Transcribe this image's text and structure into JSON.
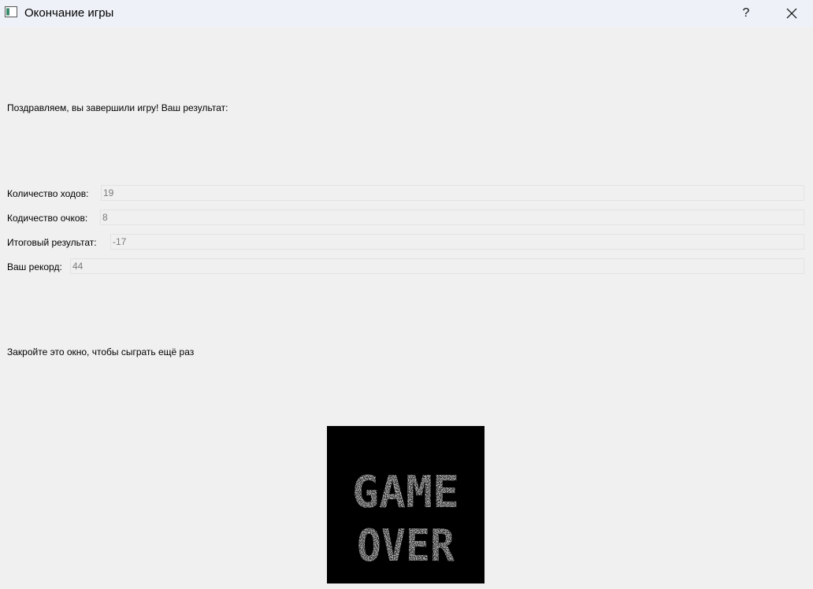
{
  "window": {
    "title": "Окончание игры",
    "help_label": "?"
  },
  "congrats_text": "Поздравляем, вы завершили игру! Ваш результат:",
  "fields": [
    {
      "label": "Количество ходов:",
      "value": "19"
    },
    {
      "label": "Кодичество очков:",
      "value": "8"
    },
    {
      "label": "Итоговый результат:",
      "value": "-17"
    },
    {
      "label": "Ваш рекорд:",
      "value": "44"
    }
  ],
  "hint_text": "Закройте это окно, чтобы сыграть ещё раз",
  "image": {
    "line1": "GAME",
    "line2": "OVER"
  }
}
